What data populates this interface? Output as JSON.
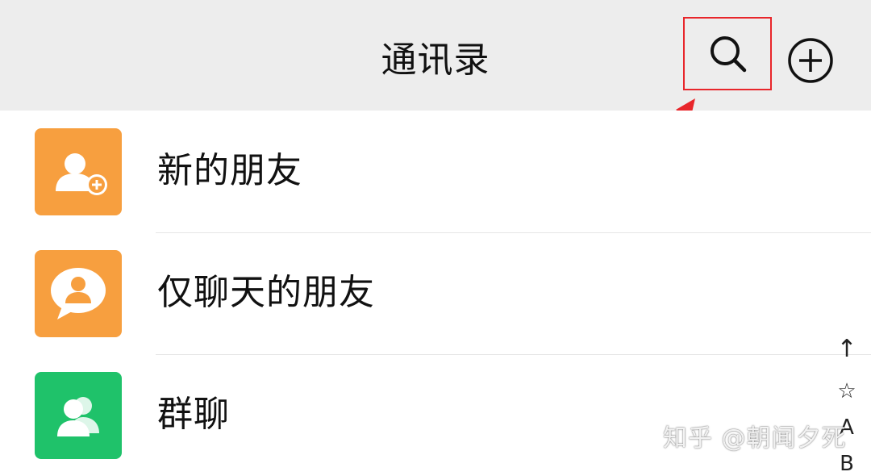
{
  "header": {
    "title": "通讯录",
    "search_icon": "search-icon",
    "add_icon": "add-circle-icon",
    "highlight_color": "#e8262b"
  },
  "contacts_menu": [
    {
      "label": "新的朋友",
      "icon": "add-friend-icon",
      "color": "#fa9d3b"
    },
    {
      "label": "仅聊天的朋友",
      "icon": "chat-only-friend-icon",
      "color": "#fa9d3b"
    },
    {
      "label": "群聊",
      "icon": "group-chat-icon",
      "color": "#1ec46a"
    }
  ],
  "index_bar": [
    "↑",
    "☆",
    "A",
    "B"
  ],
  "watermark": "知乎 @朝闻夕死"
}
